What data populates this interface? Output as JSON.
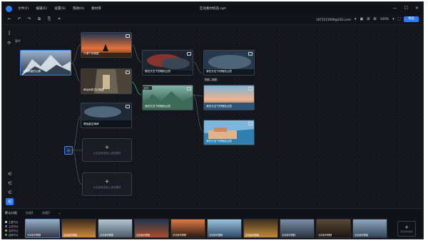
{
  "menubar": {
    "items": [
      "文件(F)",
      "编辑(E)",
      "设置(S)",
      "帮助(H)",
      "素材库"
    ],
    "title": "互动素材校验.npt",
    "window_buttons": [
      "—",
      "☐",
      "✕"
    ]
  },
  "toolbar": {
    "account": "1875215699@163.com",
    "zoom": "100%",
    "preview_label": "预览"
  },
  "left_panel": {
    "event_label": "事件"
  },
  "nodes": [
    {
      "caption": "冰雪覆盖的山峰"
    },
    {
      "caption": "沙漠下的城堡"
    },
    {
      "caption": "峡谷间的古代城堡"
    },
    {
      "caption": "猫在天空下的暗色云层"
    },
    {
      "caption": "我在天空下的暗色云层"
    },
    {
      "caption": "我在天空下的暗色云层"
    },
    {
      "caption": "我在天空下的暗色云层"
    },
    {
      "caption": "我在天空下的暗色云层"
    },
    {
      "caption": "我在天空下的暗色云层"
    },
    {
      "caption": "黑色星空海岸"
    }
  ],
  "empty_slots": [
    {
      "text": "点击选择或拖入视频素材"
    },
    {
      "text": "点击选择或拖入视频素材"
    }
  ],
  "connection_tags": [
    "选项一",
    "视频—视频"
  ],
  "bottom": {
    "tabs": [
      "默认分组",
      "分组1",
      "分组2"
    ],
    "add_tab": "+",
    "legend": [
      {
        "label": "主要节点",
        "color": "#e6e8ec"
      },
      {
        "label": "主线节点",
        "color": "#3b82f6"
      },
      {
        "label": "支线节点",
        "color": "#f59e0b"
      },
      {
        "label": "结局节点",
        "color": "#22c55e"
      }
    ],
    "thumbnails": [
      {
        "caption": "互动素材视频"
      },
      {
        "caption": "互动素材视频"
      },
      {
        "caption": "互动素材视频"
      },
      {
        "caption": "互动素材视频"
      },
      {
        "caption": "互动素材视频"
      },
      {
        "caption": "互动素材视频"
      },
      {
        "caption": "互动素材视频"
      },
      {
        "caption": "互动素材视频"
      },
      {
        "caption": "互动素材视频"
      },
      {
        "caption": "互动素材视频"
      },
      {
        "caption": "互动素材视频"
      }
    ],
    "add_label": "添加视频素材"
  },
  "icons": {
    "back": "↺",
    "forward": "↻"
  }
}
